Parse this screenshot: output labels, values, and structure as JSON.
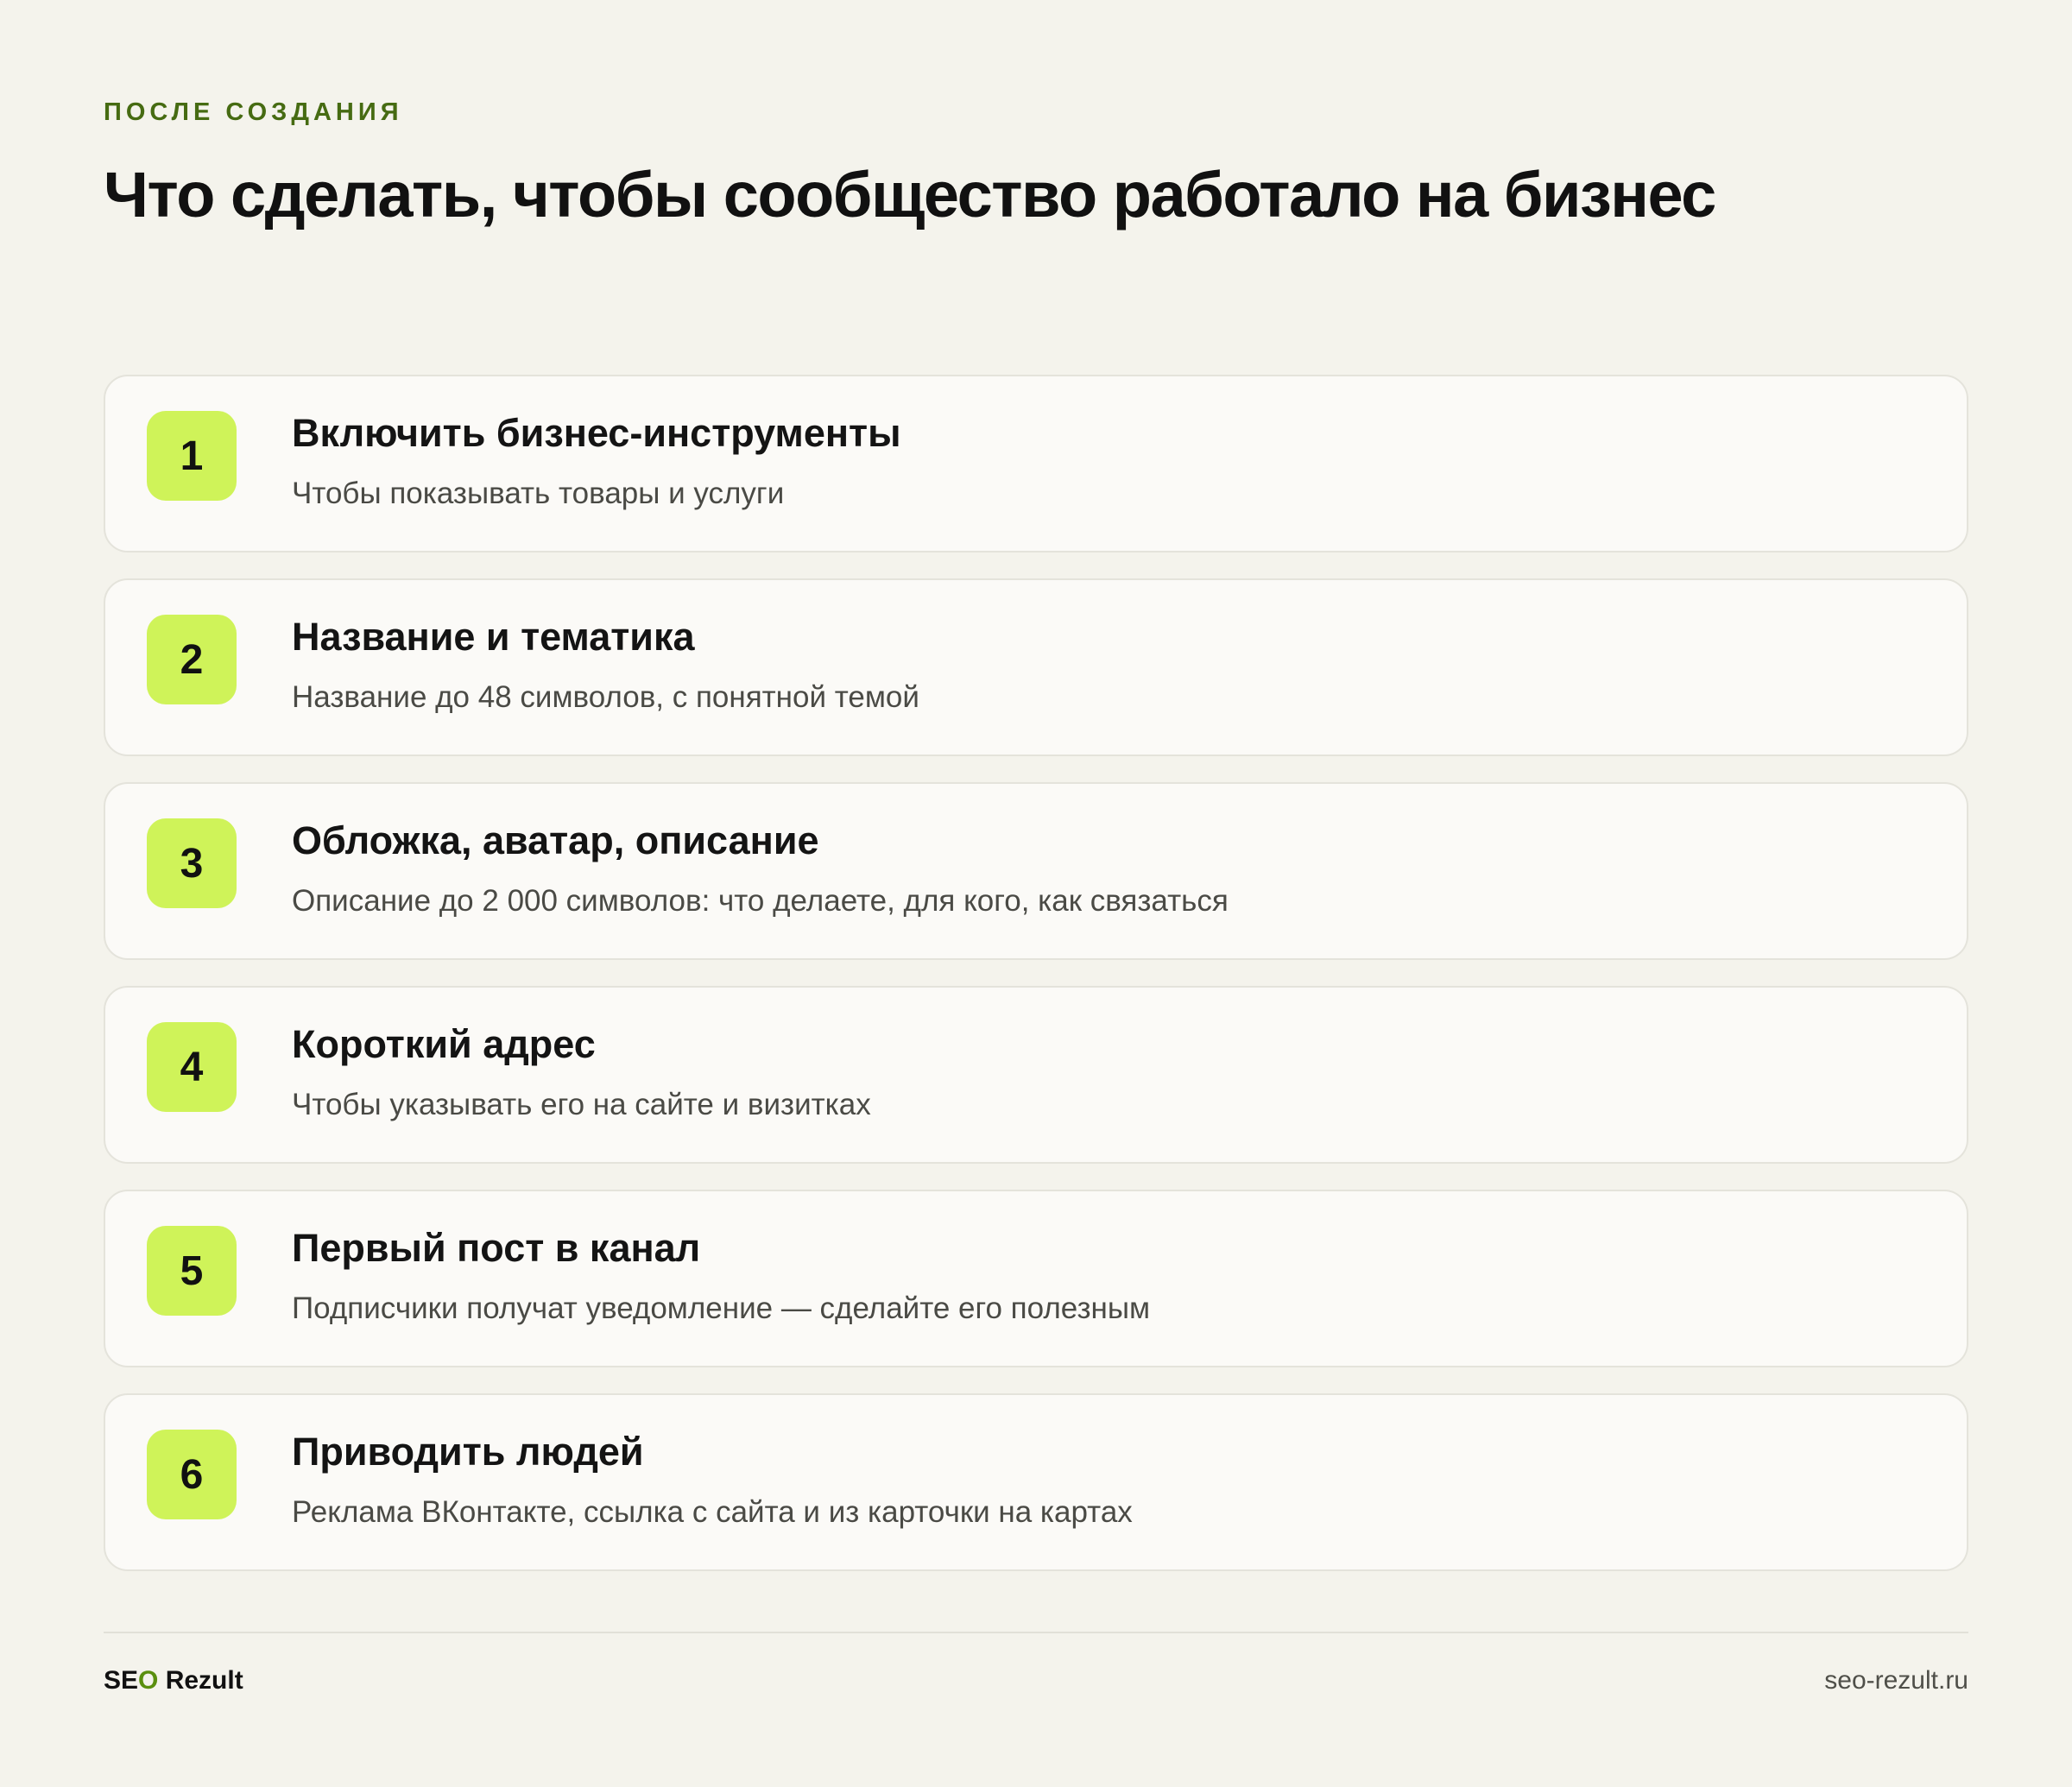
{
  "header": {
    "eyebrow": "ПОСЛЕ СОЗДАНИЯ",
    "title": "Что сделать, чтобы сообщество работало на бизнес"
  },
  "steps": [
    {
      "number": "1",
      "title": "Включить бизнес-инструменты",
      "description": "Чтобы показывать товары и услуги"
    },
    {
      "number": "2",
      "title": "Название и тематика",
      "description": "Название до 48 символов, с понятной темой"
    },
    {
      "number": "3",
      "title": "Обложка, аватар, описание",
      "description": "Описание до 2 000 символов: что делаете, для кого, как связаться"
    },
    {
      "number": "4",
      "title": "Короткий адрес",
      "description": "Чтобы указывать его на сайте и визитках"
    },
    {
      "number": "5",
      "title": "Первый пост в канал",
      "description": "Подписчики получат уведомление — сделайте его полезным"
    },
    {
      "number": "6",
      "title": "Приводить людей",
      "description": "Реклама ВКонтакте, ссылка с сайта и из карточки на картах"
    }
  ],
  "footer": {
    "brand_prefix": "SE",
    "brand_accent": "O",
    "brand_suffix": " Rezult",
    "site": "seo-rezult.ru"
  },
  "colors": {
    "background": "#f4f3ec",
    "card": "#fbfaf7",
    "badge": "#cff359",
    "eyebrow": "#466b12",
    "brand_accent": "#5a8f0e"
  }
}
